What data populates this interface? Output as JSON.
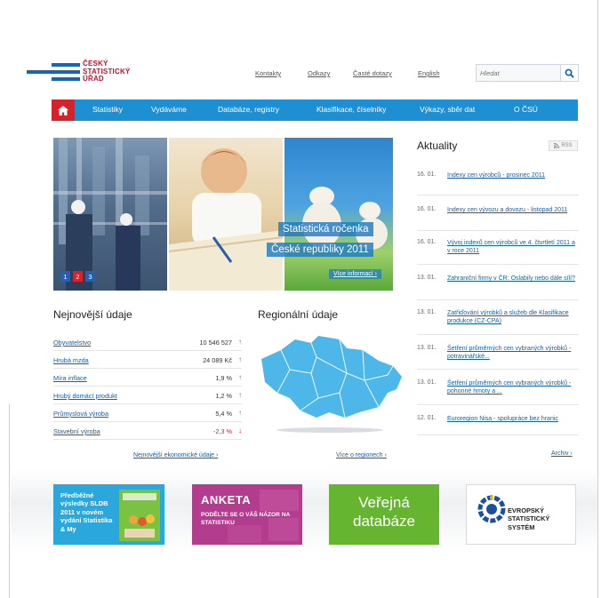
{
  "header": {
    "logo_lines": [
      "ČESKÝ",
      "STATISTICKÝ",
      "ÚŘAD"
    ],
    "links": [
      "Kontakty",
      "Odkazy",
      "Časté dotazy",
      "English"
    ],
    "search_placeholder": "Hledat"
  },
  "nav": {
    "items": [
      "Statistiky",
      "Vydáváme",
      "Databáze, registry",
      "Klasifikace, číselníky",
      "Výkazy, sběr dat",
      "O ČSÚ"
    ]
  },
  "hero": {
    "caption_line1": "Statistická ročenka",
    "caption_line2": "České republiky 2011",
    "more_link": "Více informací ›",
    "pages": [
      "1",
      "2",
      "3"
    ],
    "active_page": "2"
  },
  "latest": {
    "heading": "Nejnovější údaje",
    "rows": [
      {
        "label": "Obyvatelstvo",
        "value": "10 546 527",
        "trend": "up"
      },
      {
        "label": "Hrubá mzda",
        "value": "24 089 Kč",
        "trend": "up"
      },
      {
        "label": "Míra inflace",
        "value": "1,9 %",
        "trend": "up"
      },
      {
        "label": "Hrubý domácí produkt",
        "value": "1,2 %",
        "trend": "up"
      },
      {
        "label": "Průmyslová výroba",
        "value": "5,4 %",
        "trend": "up"
      },
      {
        "label": "Stavební výroba",
        "value": "-2,3 %",
        "trend": "down"
      }
    ],
    "more_link": "Nejnovější ekonomické údaje ›"
  },
  "regional": {
    "heading": "Regionální údaje",
    "more_link": "Více o regionech ›"
  },
  "news": {
    "heading": "Aktuality",
    "rss_label": "RSS",
    "items": [
      {
        "date": "16. 01.",
        "title": "Indexy cen výrobců - prosinec 2011"
      },
      {
        "date": "16. 01.",
        "title": "Indexy cen vývozu a dovozu - listopad 2011"
      },
      {
        "date": "16. 01.",
        "title": "Vývoj indexů cen výrobců ve 4. čtvrtletí 2011 a v roce 2011"
      },
      {
        "date": "13. 01.",
        "title": "Zahraniční firmy v ČR: Oslabily nebo dále sílí?"
      },
      {
        "date": "13. 01.",
        "title": "Zatřiďování výrobků a služeb dle Klasifikace produkce (CZ-CPA)"
      },
      {
        "date": "13. 01.",
        "title": "Šetření průměrných cen vybraných výrobků - potravinářské..."
      },
      {
        "date": "13. 01.",
        "title": "Šetření průměrných cen vybraných výrobků - pohonné hmoty a ..."
      },
      {
        "date": "12. 01.",
        "title": "Euroregion Nisa - spolupráce bez hranic"
      }
    ],
    "archive_link": "Archiv ›"
  },
  "banners": {
    "sldb": "Předběžné výsledky SLDB 2011 v novém vydání Statistika & My",
    "anketa_title": "ANKETA",
    "anketa_text": "PODĚLTE SE O VÁŠ NÁZOR NA STATISTIKU",
    "databaze": "Veřejná databáze",
    "ess": "EVROPSKÝ STATISTICKÝ SYSTÉM"
  },
  "colors": {
    "brand_blue": "#1d8fd2",
    "brand_red": "#d6222a",
    "trend_up": "#3a9a2a",
    "trend_down": "#d6222a"
  }
}
